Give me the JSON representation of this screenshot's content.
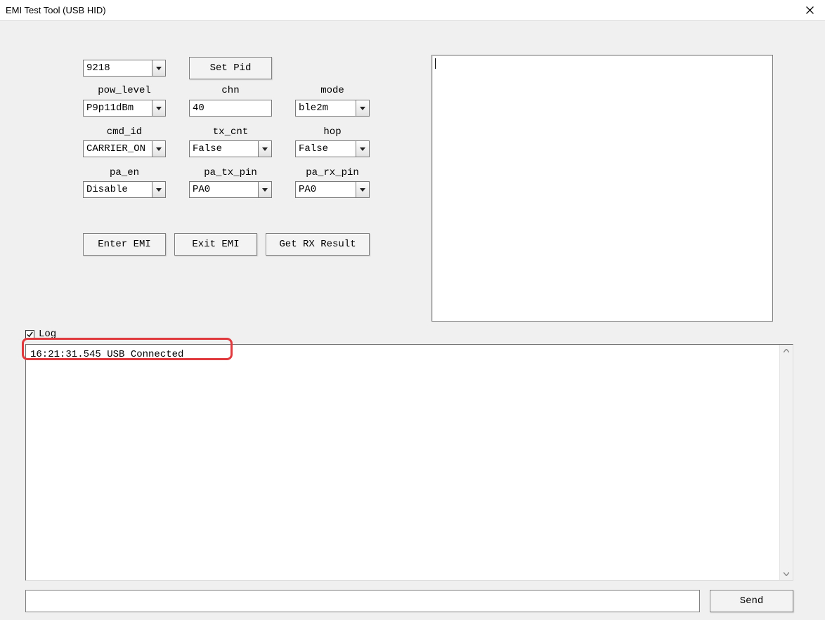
{
  "window": {
    "title": "EMI Test Tool (USB HID)"
  },
  "controls": {
    "pid_value": "9218",
    "set_pid_btn": "Set Pid",
    "pow_level": {
      "label": "pow_level",
      "value": "P9p11dBm"
    },
    "chn": {
      "label": "chn",
      "value": "40"
    },
    "mode": {
      "label": "mode",
      "value": "ble2m"
    },
    "cmd_id": {
      "label": "cmd_id",
      "value": "CARRIER_ON"
    },
    "tx_cnt": {
      "label": "tx_cnt",
      "value": "False"
    },
    "hop": {
      "label": "hop",
      "value": "False"
    },
    "pa_en": {
      "label": "pa_en",
      "value": "Disable"
    },
    "pa_tx_pin": {
      "label": "pa_tx_pin",
      "value": "PA0"
    },
    "pa_rx_pin": {
      "label": "pa_rx_pin",
      "value": "PA0"
    },
    "enter_emi_btn": "Enter EMI",
    "exit_emi_btn": "Exit EMI",
    "get_rx_btn": "Get RX Result"
  },
  "log": {
    "checkbox_label": "Log",
    "checked": true,
    "entries": [
      "16:21:31.545 USB Connected"
    ]
  },
  "send": {
    "input": "",
    "button": "Send"
  },
  "output": {
    "text": ""
  }
}
